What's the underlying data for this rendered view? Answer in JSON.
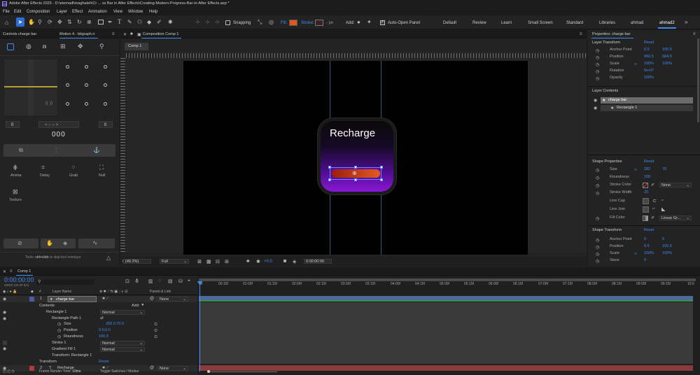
{
  "app": {
    "title": "Adobe After Effects 2025 - D:\\etemadi\\maghaleh\\Cr ... ss Bar in After Effects\\Creating-Modern-Progress-Bar-in-After Effects.aep *",
    "menu": [
      "File",
      "Edit",
      "Composition",
      "Layer",
      "Effect",
      "Animation",
      "View",
      "Window",
      "Help"
    ]
  },
  "toolbar": {
    "snapping": "Snapping",
    "fill": "Fill:",
    "stroke": "Stroke:",
    "stroke_unit": "- px",
    "add": "Add:",
    "auto_open": "Auto-Open Panel",
    "workspaces": [
      "Default",
      "Review",
      "Learn",
      "Small Screen",
      "Standard",
      "Libraries",
      "ahmad",
      "ahmad2"
    ],
    "active_workspace": "ahmad2"
  },
  "left_panel": {
    "tab1": "Controls charge bar",
    "tab2": "Motion 4 - bitgraph.ir",
    "counter": "0",
    "counter_right": "0",
    "display": "000",
    "tools": [
      "Anima",
      "Delay",
      "Grab",
      "Null"
    ],
    "texture": "Texture",
    "tip": "Tools: ctrl+click to skip tool overlays",
    "tip_prefix": "Tools: ",
    "tip_key": "ctrl+click",
    "tip_suffix": " to skip tool overlays"
  },
  "composition": {
    "panel_tab": "Composition Comp 1",
    "tab": "Comp 1",
    "card_title": "Recharge",
    "zoom": "(49.2%)",
    "resolution": "Full",
    "exposure": "+0.0",
    "timecode": "0:00:00:00"
  },
  "properties": {
    "title": "Properties: charge bar",
    "layer_transform": "Layer Transform",
    "reset": "Reset",
    "anchor_point": "Anchor Point",
    "anchor_values": [
      "0.5",
      "100.5"
    ],
    "position": "Position",
    "position_values": [
      "960.5",
      "684.5"
    ],
    "scale": "Scale",
    "scale_values": [
      "100%",
      "100%"
    ],
    "rotation": "Rotation",
    "rotation_value": "0x+0°",
    "opacity": "Opacity",
    "opacity_value": "100%",
    "layer_contents": "Layer Contents",
    "contents_items": [
      "charge bar",
      "Rectangle 1"
    ],
    "shape_properties": "Shape Properties",
    "size": "Size",
    "size_values": [
      "282",
      "70"
    ],
    "roundness": "Roundness",
    "roundness_value": "100",
    "stroke_color": "Stroke Color",
    "stroke_select": "None",
    "stroke_width": "Stroke Width",
    "stroke_width_value": "20",
    "line_cap": "Line Cap",
    "line_join": "Line Join",
    "fill_color": "Fill Color",
    "fill_select": "Linear Gr...",
    "shape_transform": "Shape Transform",
    "st_anchor": "Anchor Point",
    "st_anchor_values": [
      "0",
      "0"
    ],
    "st_position": "Position",
    "st_position_values": [
      "0.5",
      "100.5"
    ],
    "st_scale": "Scale",
    "st_scale_values": [
      "100%",
      "100%"
    ],
    "st_skew": "Skew",
    "st_skew_value": "0"
  },
  "timeline": {
    "tab": "Comp 1",
    "timecode": "0:00:00:00",
    "fps": "00000 (30.00 fps)",
    "col_layer_name": "Layer Name",
    "col_parent": "Parent & Link",
    "ticks": [
      "0f",
      "00:15f",
      "01:00f",
      "01:15f",
      "02:00f",
      "02:15f",
      "03:00f",
      "03:15f",
      "04:00f",
      "04:15f",
      "05:00f",
      "05:15f",
      "06:00f",
      "06:15f",
      "07:00f",
      "07:15f",
      "08:00f",
      "08:15f",
      "09:00f",
      "09:15f",
      "10:0"
    ],
    "layers": [
      {
        "num": "1",
        "name": "charge bar",
        "mode": "Normal",
        "parent": "None"
      },
      {
        "num": "2",
        "name": "Recharge",
        "mode": "Normal",
        "parent": "None"
      }
    ],
    "rows": {
      "contents": "Contents",
      "add": "Add:",
      "rect1": "Rectangle 1",
      "rect1_mode": "Normal",
      "rect_path": "Rectangle Path 1",
      "size": "Size",
      "size_value": "282.0,70.0",
      "position": "Position",
      "position_value": "0.0,0.0",
      "roundness": "Roundness",
      "roundness_value": "100.0",
      "stroke1": "Stroke 1",
      "stroke1_mode": "Normal",
      "gradient": "Gradient Fill 1",
      "gradient_mode": "Normal",
      "transform_rect": "Transform: Rectangle 1",
      "transform": "Transform",
      "reset": "Reset"
    },
    "footer_render": "Frame Render Time:",
    "footer_render_value": "10ms",
    "footer_toggle": "Toggle Switches / Modes"
  },
  "colors": {
    "accent": "#3d8cf5",
    "fill_swatch": "#e2571e",
    "card_purple": "#8a17d6",
    "bar_orange": "#e35b1c"
  }
}
